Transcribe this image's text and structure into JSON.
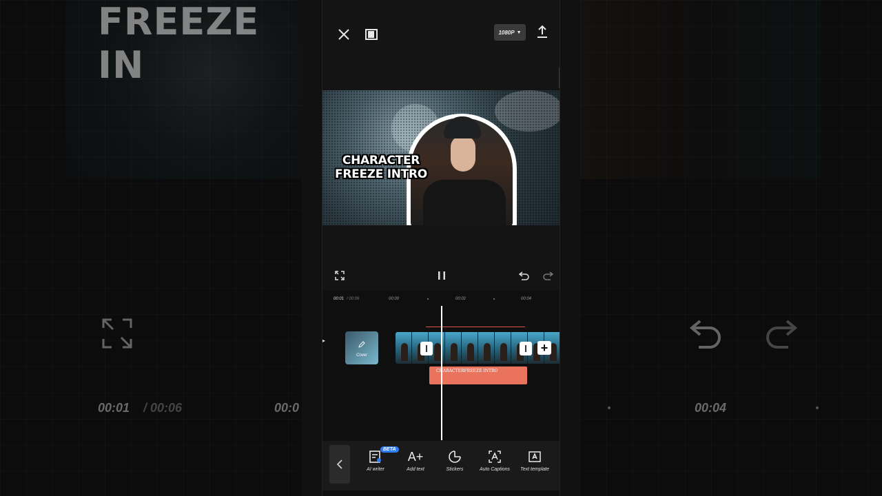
{
  "background": {
    "title_text": "FREEZE IN",
    "time_current": "00:01",
    "time_total": "/ 00:06",
    "time_mid": "00:0",
    "time_right": "00:04"
  },
  "topbar": {
    "resolution": "1080P"
  },
  "preview": {
    "title_line1": "CHARACTER",
    "title_line2": "FREEZE INTRO"
  },
  "timeline": {
    "current_time": "00:01",
    "total_time": "/ 00:06",
    "marks": [
      "00:00",
      "00:02",
      "00:04"
    ],
    "cover_label": "Cover",
    "text_clip_label": "CHARACTERFREEZE INTRO"
  },
  "toolbar": {
    "beta_badge": "BETA",
    "tools": [
      {
        "icon": "ai-writer-icon",
        "label": "AI writer"
      },
      {
        "icon": "add-text-icon",
        "label": "Add text"
      },
      {
        "icon": "stickers-icon",
        "label": "Stickers"
      },
      {
        "icon": "auto-captions-icon",
        "label": "Auto Captions"
      },
      {
        "icon": "text-template-icon",
        "label": "Text template"
      }
    ]
  },
  "colors": {
    "accent": "#2f7cf6",
    "text_clip": "#e9735c",
    "selection_line": "#e0554a"
  }
}
